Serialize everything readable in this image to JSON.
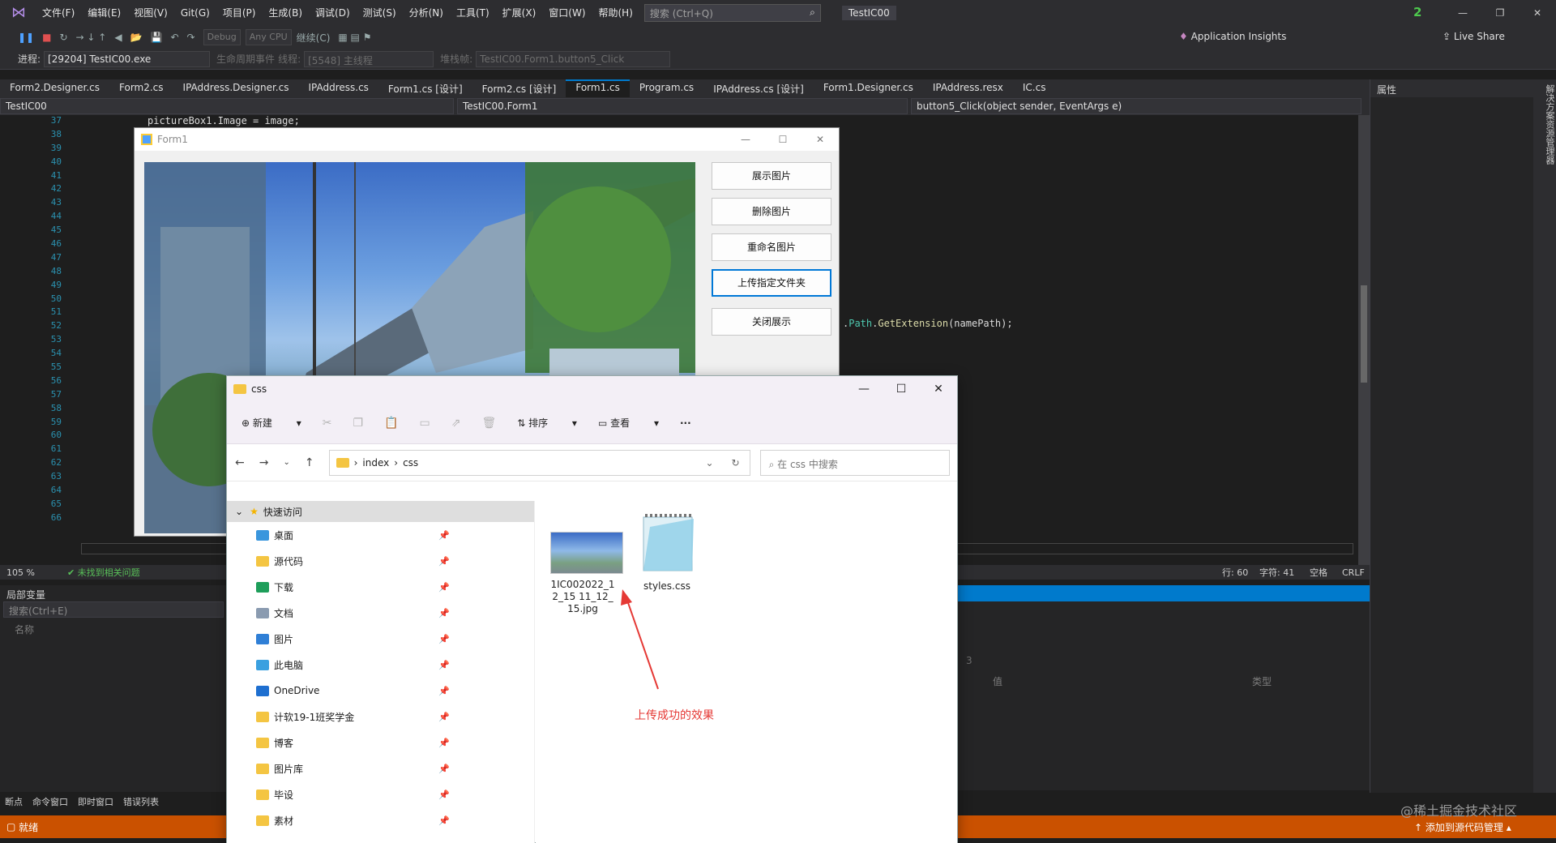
{
  "titlebar": {
    "menus": [
      "文件(F)",
      "编辑(E)",
      "视图(V)",
      "Git(G)",
      "项目(P)",
      "生成(B)",
      "调试(D)",
      "测试(S)",
      "分析(N)",
      "工具(T)",
      "扩展(X)",
      "窗口(W)",
      "帮助(H)"
    ],
    "search_placeholder": "搜索 (Ctrl+Q)",
    "solution": "TestIC00",
    "notification_count": "2"
  },
  "toolbar": {
    "config": "Debug",
    "platform": "Any CPU",
    "continue_label": "继续(C)",
    "app_insights": "Application Insights",
    "live_share": "Live Share",
    "process_label": "进程:",
    "process_value": "[29204] TestIC00.exe",
    "lifecycle_label": "生命周期事件",
    "thread_label": "线程:",
    "thread_value": "[5548] 主线程",
    "stack_label": "堆栈帧:",
    "stack_value": "TestIC00.Form1.button5_Click"
  },
  "doc_tabs": [
    "Form2.Designer.cs",
    "Form2.cs",
    "IPAddress.Designer.cs",
    "IPAddress.cs",
    "Form1.cs [设计]",
    "Form2.cs [设计]",
    "Form1.cs",
    "Program.cs",
    "IPAddress.cs [设计]",
    "Form1.Designer.cs",
    "IPAddress.resx",
    "IC.cs"
  ],
  "active_tab": "Form1.cs",
  "navbar": {
    "project": "TestIC00",
    "class": "TestIC00.Form1",
    "member": "button5_Click(object sender, EventArgs e)"
  },
  "editor": {
    "line_numbers": [
      "37",
      "38",
      "39",
      "40",
      "41",
      "42",
      "43",
      "44",
      "45",
      "46",
      "47",
      "48",
      "49",
      "50",
      "51",
      "52",
      "53",
      "54",
      "55",
      "56",
      "57",
      "58",
      "59",
      "60",
      "61",
      "62",
      "63",
      "64",
      "65",
      "66"
    ],
    "top_line": "pictureBox1.Image = image;",
    "code_path": "Path",
    "code_method": "GetExtension",
    "code_args": "(namePath);"
  },
  "edit_status": {
    "zoom": "105 %",
    "issues": "未找到相关问题",
    "line": "行: 60",
    "char": "字符: 41",
    "space": "空格",
    "eol": "CRLF"
  },
  "locals": {
    "title": "局部变量",
    "search_placeholder": "搜索(Ctrl+E)",
    "col_name": "名称"
  },
  "right_panel": {
    "col_value": "值",
    "col_type": "类型",
    "depth": "3"
  },
  "bottom_tabs": [
    "断点",
    "命令窗口",
    "即时窗口",
    "错误列表"
  ],
  "statusbar": {
    "ready": "就绪",
    "source_control": "添加到源代码管理"
  },
  "props": {
    "title": "属性",
    "side_label": "解决方案资源管理器"
  },
  "form1": {
    "title": "Form1",
    "buttons": [
      "展示图片",
      "删除图片",
      "重命名图片",
      "上传指定文件夹",
      "关闭展示"
    ]
  },
  "explorer": {
    "title": "css",
    "cmd": {
      "new": "新建",
      "sort": "排序",
      "view": "查看",
      "more": "···"
    },
    "path": [
      "index",
      "css"
    ],
    "search_placeholder": "在 css 中搜索",
    "quick_access": "快速访问",
    "nav_items": [
      {
        "label": "桌面",
        "color": "#3a96dd"
      },
      {
        "label": "源代码",
        "color": "#f4c542"
      },
      {
        "label": "下载",
        "color": "#1e9e5a"
      },
      {
        "label": "文档",
        "color": "#8a9bb0"
      },
      {
        "label": "图片",
        "color": "#2f7fd6"
      },
      {
        "label": "此电脑",
        "color": "#3aa0e0"
      },
      {
        "label": "OneDrive",
        "color": "#1e6fd0"
      },
      {
        "label": "计软19-1班奖学金",
        "color": "#f4c542"
      },
      {
        "label": "博客",
        "color": "#f4c542"
      },
      {
        "label": "图片库",
        "color": "#f4c542"
      },
      {
        "label": "毕设",
        "color": "#f4c542"
      },
      {
        "label": "素材",
        "color": "#f4c542"
      }
    ],
    "files": [
      {
        "name": "1IC002022_12_15 11_12_15.jpg",
        "kind": "jpg"
      },
      {
        "name": "styles.css",
        "kind": "css"
      }
    ]
  },
  "annotation": "上传成功的效果",
  "watermark": "@稀土掘金技术社区"
}
